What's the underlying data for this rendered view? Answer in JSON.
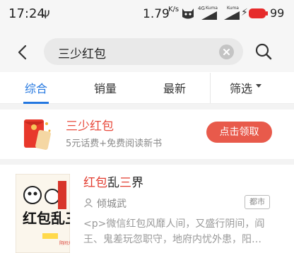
{
  "status_bar": {
    "time": "17:24",
    "usb_glyph": "Ψ",
    "net_speed_value": "1.79",
    "net_speed_unit": "K/s",
    "network_type": "4G",
    "carrier_1": "Kuma",
    "carrier_2": "Kuma",
    "battery_level": "99",
    "icons": [
      "usb-icon",
      "cat-icon",
      "signal-icon",
      "charging-icon",
      "battery-icon"
    ]
  },
  "search": {
    "query": "三少红包",
    "icons": [
      "back-arrow-icon",
      "clear-icon",
      "search-icon"
    ]
  },
  "tabs": [
    {
      "label": "综合",
      "active": true
    },
    {
      "label": "销量",
      "active": false
    },
    {
      "label": "最新",
      "active": false
    },
    {
      "label": "筛选",
      "active": false
    }
  ],
  "promo": {
    "title": "三少红包",
    "subtitle": "5元话费+免费阅读新书",
    "button": "点击领取"
  },
  "results": [
    {
      "title_parts": [
        {
          "text": "红包",
          "highlight": true
        },
        {
          "text": "乱",
          "highlight": false
        },
        {
          "text": "三",
          "highlight": true
        },
        {
          "text": "界",
          "highlight": false
        }
      ],
      "author": "倾城武",
      "genre": "都市",
      "description": "<p>微信红包风靡人间，又盛行阴间，阎王、鬼差玩忽职守，地府内忧外患，阳…",
      "cover": {
        "big_text": "红包乱三界",
        "side_text": "阴间大乱"
      }
    }
  ],
  "colors": {
    "accent_blue": "#2377e0",
    "highlight_red": "#e23b2e",
    "promo_button": "#e85a4b",
    "battery_red": "#e62b2b"
  }
}
